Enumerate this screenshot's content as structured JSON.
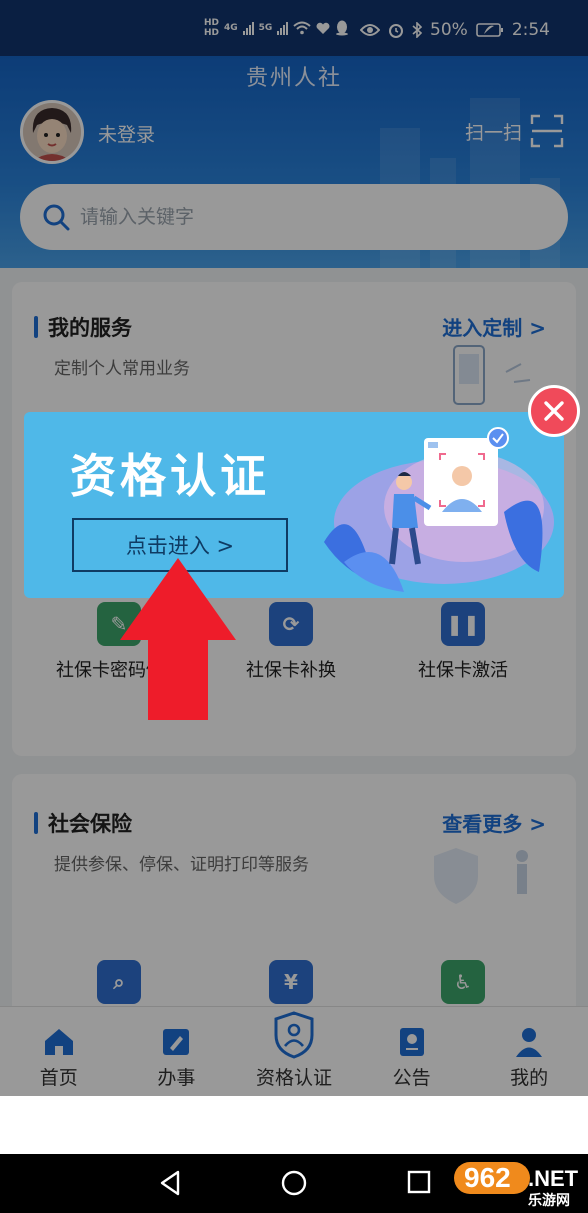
{
  "status_bar": {
    "network": [
      "HD",
      "HD"
    ],
    "sig1": "4G",
    "sig2": "5G",
    "battery": "50%",
    "time": "2:54"
  },
  "header": {
    "app_title": "贵州人社",
    "login_text": "未登录",
    "scan_label": "扫一扫",
    "search_placeholder": "请输入关键字"
  },
  "my_services": {
    "title": "我的服务",
    "subtitle": "定制个人常用业务",
    "more_label": "进入定制 >",
    "items": [
      {
        "label": "社保卡密码修改",
        "icon": "pencil-icon",
        "color": "#3da66b"
      },
      {
        "label": "社保卡补换",
        "icon": "refresh-icon",
        "color": "#2f6fd0"
      },
      {
        "label": "社保卡激活",
        "icon": "pause-icon",
        "color": "#2f6fd0"
      }
    ]
  },
  "social_insurance": {
    "title": "社会保险",
    "subtitle": "提供参保、停保、证明打印等服务",
    "more_label": "查看更多 >",
    "items": [
      {
        "icon": "search-icon",
        "color": "#2f6fd0"
      },
      {
        "icon": "yuan-icon",
        "color": "#2f6fd0"
      },
      {
        "icon": "accessibility-icon",
        "color": "#3da66b"
      }
    ]
  },
  "popup": {
    "title": "资格认证",
    "button_label": "点击进入 >"
  },
  "tabs": [
    {
      "label": "首页",
      "icon": "home-icon",
      "active": true
    },
    {
      "label": "办事",
      "icon": "edit-icon",
      "active": false
    },
    {
      "label": "资格认证",
      "icon": "shield-user-icon",
      "active": false
    },
    {
      "label": "公告",
      "icon": "notice-icon",
      "active": false
    },
    {
      "label": "我的",
      "icon": "user-icon",
      "active": false
    }
  ],
  "watermark": {
    "number": "962",
    "suffix": ".NET",
    "sub": "乐游网"
  },
  "colors": {
    "accent": "#1f6fd6",
    "popup_bg": "#4fb8e8",
    "close": "#f04a5a",
    "arrow": "#ee1c2a"
  }
}
